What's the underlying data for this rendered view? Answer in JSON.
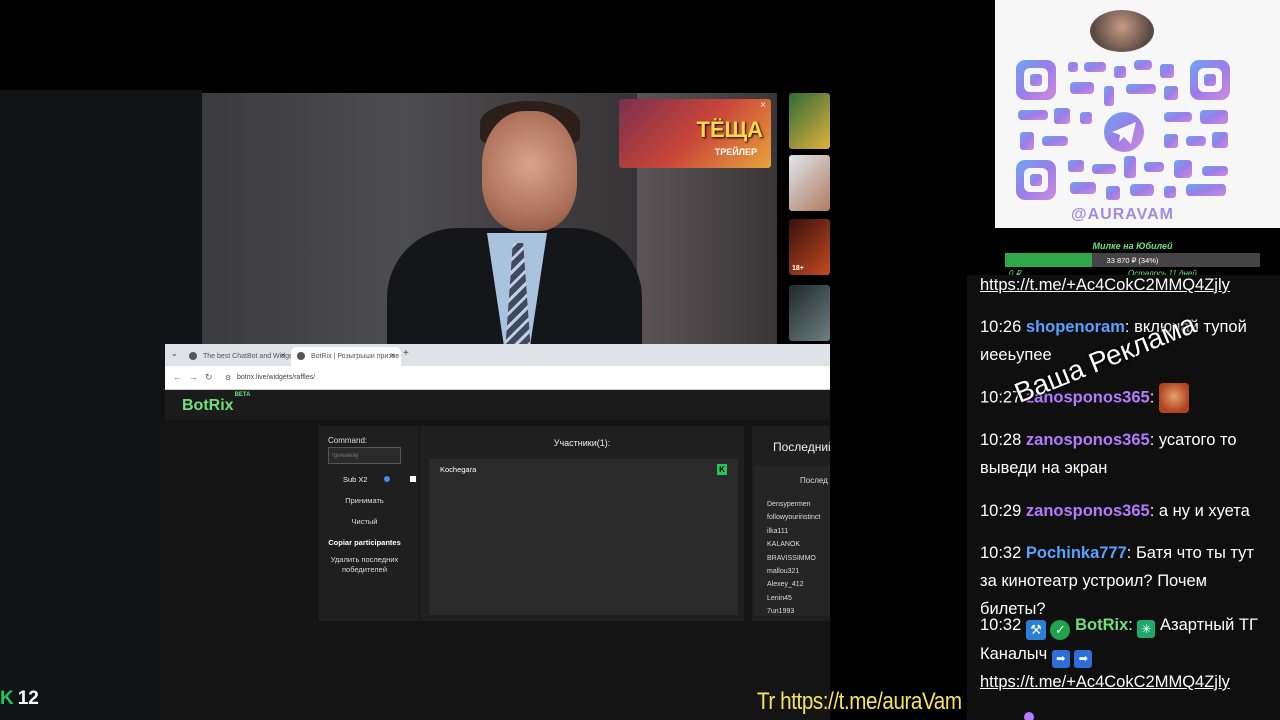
{
  "video": {
    "ad": {
      "title": "ТЁЩА",
      "subtitle": "ТРЕЙЛЕР",
      "close": "×"
    },
    "thumb_badge": "18+"
  },
  "browser": {
    "tabs": [
      {
        "label": "The best ChatBot and Widgets"
      },
      {
        "label": "BotRix | Розыгрыши призов"
      }
    ],
    "new_tab": "+",
    "url": "botrix.live/widgets/raffles/",
    "nav": {
      "back": "←",
      "forward": "→",
      "reload": "↻"
    }
  },
  "app": {
    "logo": "BotRix",
    "logo_badge": "BETA",
    "command": {
      "label": "Command:",
      "placeholder": "!giveaway",
      "sub_label": "Sub X2",
      "buttons": [
        "Принимать",
        "Чистый",
        "Copiar participantes",
        "Удалить последних победителей"
      ]
    },
    "participants": {
      "title": "Участники(1):",
      "items": [
        {
          "name": "Kochegara",
          "badge": "K"
        }
      ]
    },
    "last": {
      "title": "Последний",
      "subtitle": "Послед",
      "winners": [
        "Densypermen",
        "followyourinstinct",
        "ilka111",
        "KALANOK",
        "BRAVISSIMMO",
        "mallou321",
        "Alexey_412",
        "Lenin45",
        "7un1993"
      ]
    }
  },
  "sidebar": {
    "qr_handle": "@AURAVAM",
    "goal": {
      "title": "Милке на Юбилей",
      "progress_text": "33 870 ₽ (34%)",
      "progress": 0.34,
      "left": "0 ₽",
      "remain": "Осталось 11 дней"
    },
    "promo": "Ваша Реклама",
    "chat": [
      {
        "time": "",
        "user": "",
        "text": "",
        "link": "https://t.me/+Ac4CokC2MMQ4Zjly"
      },
      {
        "time": "10:26",
        "user": "shopenoram",
        "color": "#5aa0ff",
        "text": "включай тупой иееьупее"
      },
      {
        "time": "10:27",
        "user": "zanosponos365",
        "color": "#b57bff",
        "text": "",
        "emote": "face-emote"
      },
      {
        "time": "10:28",
        "user": "zanosponos365",
        "color": "#b57bff",
        "text": "усатого то выведи на экран"
      },
      {
        "time": "10:29",
        "user": "zanosponos365",
        "color": "#b57bff",
        "text": "а ну и хуета"
      },
      {
        "time": "10:32",
        "user": "Pochinka777",
        "color": "#5aa0ff",
        "text": "Батя что ты тут за кинотеатр устроил? Почем билеты?"
      },
      {
        "time": "10:32",
        "user": "BotRix",
        "color": "#6fe07a",
        "text": "Азартный ТГ Каналыч",
        "link": "https://t.me/+Ac4CokC2MMQ4Zjly"
      }
    ]
  },
  "overlay": {
    "viewers": "12",
    "tg_link": "Tr https://t.me/auraVam"
  }
}
